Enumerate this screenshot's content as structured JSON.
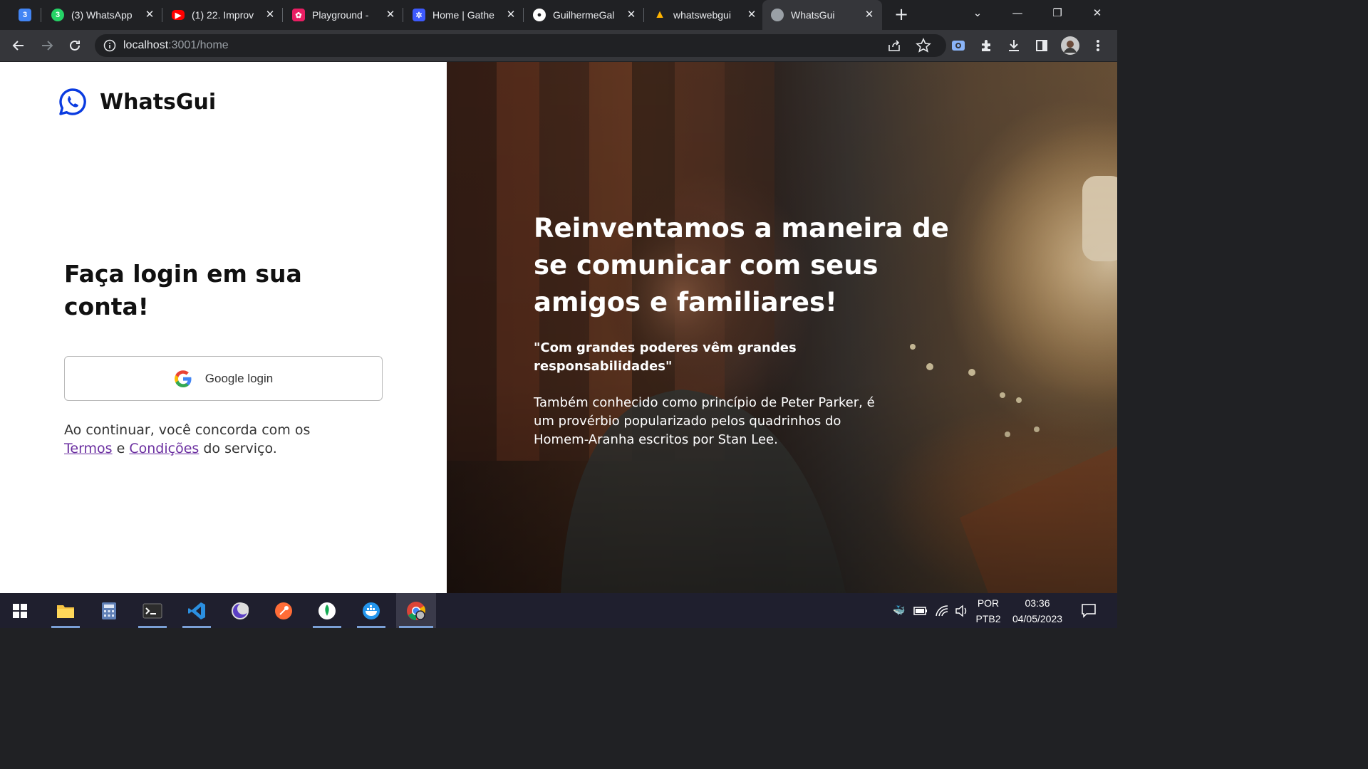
{
  "browser": {
    "tabs": [
      {
        "title": "",
        "favicon": "calendar-icon",
        "color": "#4285f4",
        "badge": "3"
      },
      {
        "title": "(3) WhatsApp",
        "favicon": "whatsapp-icon",
        "color": "#25d366"
      },
      {
        "title": "(1) 22. Improv",
        "favicon": "youtube-icon",
        "color": "#ff0000"
      },
      {
        "title": "Playground - ",
        "favicon": "playground-icon",
        "color": "#e91e63"
      },
      {
        "title": "Home | Gathe",
        "favicon": "gather-icon",
        "color": "#3d5afe"
      },
      {
        "title": "GuilhermeGal",
        "favicon": "github-icon",
        "color": "#ffffff"
      },
      {
        "title": "whatswebgui",
        "favicon": "vercel-icon",
        "color": "#ffb300"
      },
      {
        "title": "WhatsGui",
        "favicon": "globe-icon",
        "color": "#9aa0a6",
        "active": true
      }
    ],
    "url_host": "localhost",
    "url_rest": ":3001/home"
  },
  "page": {
    "brand_name": "WhatsGui",
    "login_title": "Faça login em sua conta!",
    "google_button": "Google login",
    "terms_prefix": "Ao continuar, você concorda com os",
    "terms_link": "Termos",
    "terms_and": "e",
    "conditions_link": "Condições",
    "terms_suffix": "do serviço.",
    "hero_title": "Reinventamos a maneira de se comunicar com seus amigos e familiares!",
    "quote": "\"Com grandes poderes vêm grandes responsabilidades\"",
    "description": "Também conhecido como princípio de Peter Parker, é um provérbio popularizado pelos quadrinhos do Homem-Aranha escritos por Stan Lee."
  },
  "taskbar": {
    "language": "POR",
    "layout": "PTB2",
    "time": "03:36",
    "date": "04/05/2023"
  },
  "colors": {
    "brand_blue": "#0a3be0",
    "link_purple": "#6b2fa0"
  }
}
